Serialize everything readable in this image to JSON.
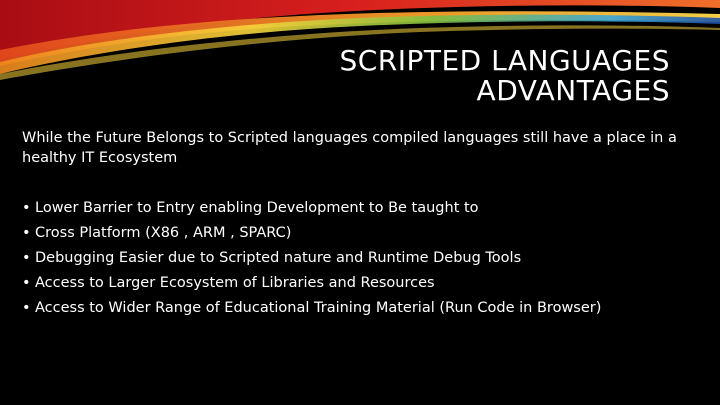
{
  "slide": {
    "title_lines": [
      "SCRIPTED LANGUAGES",
      "ADVANTAGES"
    ],
    "intro": "While the Future Belongs to Scripted languages compiled languages still have a place in a healthy IT Ecosystem",
    "bullet_glyph": "•",
    "bullets": [
      "Lower Barrier to Entry enabling Development to Be taught to",
      "Cross Platform (X86 , ARM , SPARC)",
      "Debugging Easier due to Scripted nature and Runtime Debug Tools",
      "Access to Larger Ecosystem of Libraries and Resources",
      "Access to Wider Range of Educational Training Material (Run Code in Browser)"
    ]
  },
  "colors": {
    "background": "#000000",
    "text": "#ffffff",
    "swoosh_red": "#c8101a",
    "swoosh_orange": "#f39a1e",
    "swoosh_yellow": "#f7d43a",
    "swoosh_green": "#7fbf3f",
    "swoosh_blue": "#3aa6d8"
  },
  "decorations": {
    "swoosh": "decorative-swoosh-graphic"
  }
}
